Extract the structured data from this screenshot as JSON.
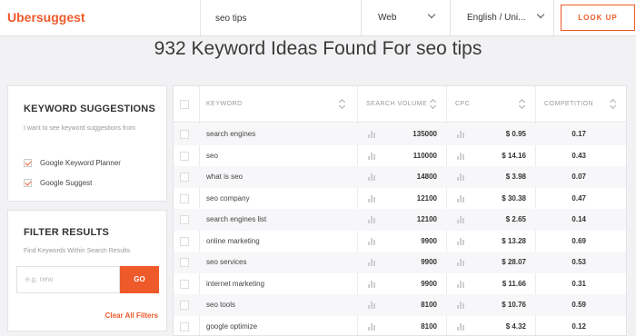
{
  "app": {
    "logo": "Ubersuggest"
  },
  "search": {
    "value": "seo tips"
  },
  "filters": {
    "source": "Web",
    "language": "English / Uni..."
  },
  "buttons": {
    "lookup": "LOOK UP",
    "go": "GO",
    "clear_filters": "Clear All Filters"
  },
  "heading": "932 Keyword Ideas Found For seo tips",
  "suggestions_panel": {
    "title": "KEYWORD SUGGESTIONS",
    "subtitle": "I want to see keyword suggestions from",
    "options": [
      {
        "label": "Google Keyword Planner",
        "checked": true
      },
      {
        "label": "Google Suggest",
        "checked": true
      }
    ]
  },
  "filter_panel": {
    "title": "FILTER RESULTS",
    "subtitle": "Find Keywords Within Search Results",
    "placeholder": "e.g. new"
  },
  "table": {
    "headers": {
      "keyword": "KEYWORD",
      "volume": "SEARCH VOLUME",
      "cpc": "CPC",
      "competition": "COMPETITION"
    },
    "rows": [
      {
        "keyword": "search engines",
        "volume": "135000",
        "cpc": "$ 0.95",
        "competition": "0.17"
      },
      {
        "keyword": "seo",
        "volume": "110000",
        "cpc": "$ 14.16",
        "competition": "0.43"
      },
      {
        "keyword": "what is seo",
        "volume": "14800",
        "cpc": "$ 3.98",
        "competition": "0.07"
      },
      {
        "keyword": "seo company",
        "volume": "12100",
        "cpc": "$ 30.38",
        "competition": "0.47"
      },
      {
        "keyword": "search engines list",
        "volume": "12100",
        "cpc": "$ 2.65",
        "competition": "0.14"
      },
      {
        "keyword": "online marketing",
        "volume": "9900",
        "cpc": "$ 13.28",
        "competition": "0.69"
      },
      {
        "keyword": "seo services",
        "volume": "9900",
        "cpc": "$ 28.07",
        "competition": "0.53"
      },
      {
        "keyword": "internet marketing",
        "volume": "9900",
        "cpc": "$ 11.66",
        "competition": "0.31"
      },
      {
        "keyword": "seo tools",
        "volume": "8100",
        "cpc": "$ 10.76",
        "competition": "0.59"
      },
      {
        "keyword": "google optimize",
        "volume": "8100",
        "cpc": "$ 4.32",
        "competition": "0.12"
      }
    ]
  },
  "colors": {
    "accent": "#ef5a2a"
  }
}
